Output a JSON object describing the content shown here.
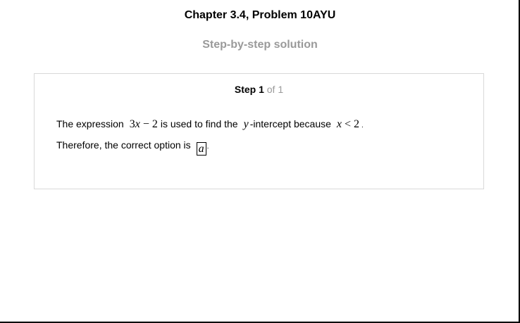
{
  "header": {
    "title": "Chapter 3.4, Problem 10AYU",
    "subtitle": "Step-by-step solution"
  },
  "step": {
    "label": "Step 1",
    "of_text": "of 1"
  },
  "solution": {
    "line1": {
      "prefix": "The expression",
      "expr_coef": "3",
      "expr_var": "x",
      "expr_rest": " − 2",
      "middle": "is used to find the",
      "var": "y",
      "suffix": "-intercept because",
      "ineq_var": "x",
      "ineq_rest": " < 2",
      "end": "."
    },
    "line2": {
      "prefix": "Therefore, the correct option is",
      "answer": "a",
      "end": "."
    }
  }
}
